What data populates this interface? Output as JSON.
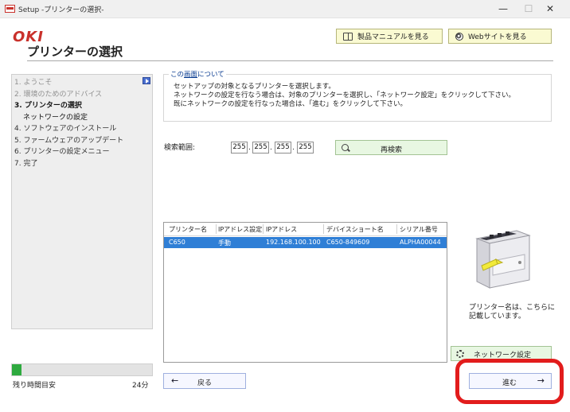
{
  "window": {
    "title": "Setup -プリンターの選択-",
    "min_icon": "minimize-icon",
    "max_icon": "maximize-icon",
    "close_icon": "close-icon",
    "min_glyph": "—",
    "max_glyph": "☐",
    "close_glyph": "✕"
  },
  "brand": {
    "logo": "OKI",
    "color": "#c9312b"
  },
  "header": {
    "title": "プリンターの選択",
    "manual_button": "製品マニュアルを見る",
    "web_button": "Webサイトを見る"
  },
  "sidebar": {
    "steps": [
      {
        "label": "1. ようこそ",
        "state": "done"
      },
      {
        "label": "2. 環境のためのアドバイス",
        "state": "done"
      },
      {
        "label": "3. プリンターの選択",
        "state": "current"
      },
      {
        "label": "ネットワークの設定",
        "state": "sub"
      },
      {
        "label": "4. ソフトウェアのインストール",
        "state": "todo"
      },
      {
        "label": "5. ファームウェアのアップデート",
        "state": "todo"
      },
      {
        "label": "6. プリンターの設定メニュー",
        "state": "todo"
      },
      {
        "label": "7. 完了",
        "state": "todo"
      }
    ]
  },
  "progress": {
    "label": "残り時間目安",
    "value": "24分",
    "fraction": 0.07,
    "color": "#2eaa3f"
  },
  "info": {
    "legend_prefix": "この",
    "legend_link": "画面",
    "legend_suffix": "について",
    "lines": [
      "セットアップの対象となるプリンターを選択します。",
      "ネットワークの設定を行なう場合は、対象のプリンターを選択し、「ネットワーク設定」をクリックして下さい。",
      "既にネットワークの設定を行なった場合は、「進む」をクリックして下さい。"
    ]
  },
  "search": {
    "label": "検索範囲:",
    "octets": [
      "255",
      "255",
      "255",
      "255"
    ],
    "dot": ".",
    "rescan_button": "再検索"
  },
  "printer_table": {
    "columns": [
      "プリンター名",
      "IPアドレス設定",
      "IPアドレス",
      "デバイスショート名",
      "シリアル番号"
    ],
    "rows": [
      {
        "name": "C650",
        "ip_setting": "手動",
        "ip": "192.168.100.100",
        "short_name": "C650-849609",
        "serial": "ALPHA00044",
        "selected": true
      }
    ],
    "selection_color": "#2f7fd6"
  },
  "printer_image": {
    "caption_line1": "プリンター名は、こちらに",
    "caption_line2": "記載しています。"
  },
  "network_button": "ネットワーク設定",
  "nav": {
    "back_label": "戻る",
    "next_label": "進む",
    "back_arrow": "←",
    "next_arrow": "→"
  },
  "highlight_color": "#e21c1c"
}
